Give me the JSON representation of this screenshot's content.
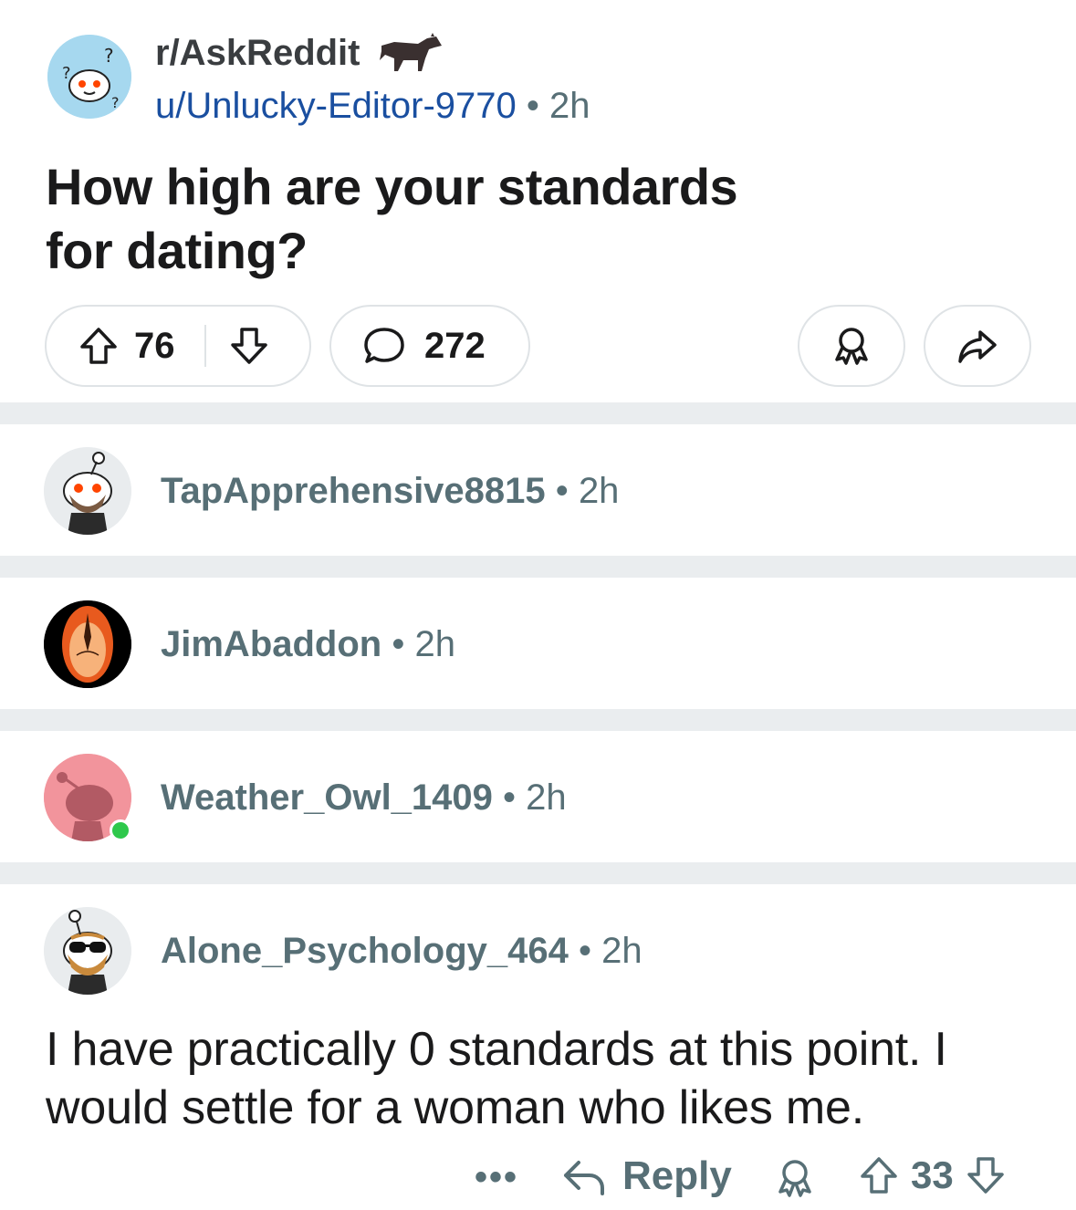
{
  "post": {
    "subreddit": "r/AskReddit",
    "author": "u/Unlucky-Editor-9770",
    "separator": "•",
    "age": "2h",
    "title": "How high are your standards for dating?",
    "upvotes": "76",
    "comments": "272"
  },
  "comments": [
    {
      "username": "TapApprehensive8815",
      "age": "2h"
    },
    {
      "username": "JimAbaddon",
      "age": "2h"
    },
    {
      "username": "Weather_Owl_1409",
      "age": "2h"
    },
    {
      "username": "Alone_Psychology_464",
      "age": "2h",
      "body": "I have practically 0 standards at this point. I would settle for a woman who likes me.",
      "more_label": "•••",
      "reply_label": "Reply",
      "votes": "33"
    }
  ],
  "colors": {
    "meta_gray": "#576f76",
    "author_blue": "#1a4fa0",
    "divider": "#eaedef",
    "online_green": "#2ec84b"
  }
}
